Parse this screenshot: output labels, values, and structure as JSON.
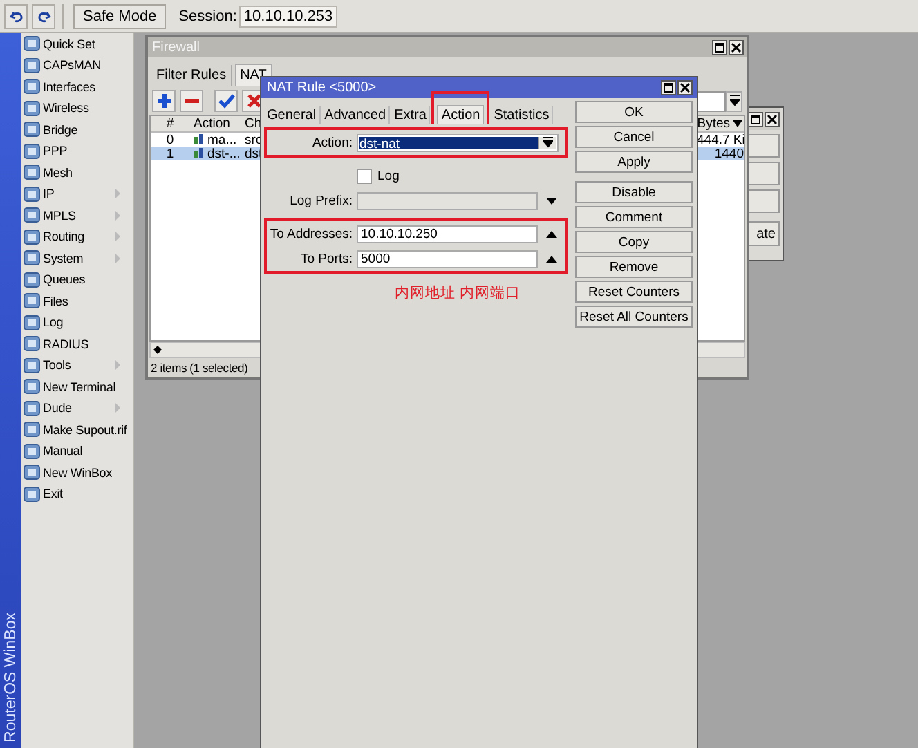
{
  "toolbar": {
    "safe_mode": "Safe Mode",
    "session_label": "Session:",
    "session": "10.10.10.253"
  },
  "sidebar": {
    "brand": "RouterOS WinBox",
    "items": [
      {
        "label": "Quick Set",
        "submenu": false
      },
      {
        "label": "CAPsMAN",
        "submenu": false
      },
      {
        "label": "Interfaces",
        "submenu": false
      },
      {
        "label": "Wireless",
        "submenu": false
      },
      {
        "label": "Bridge",
        "submenu": false
      },
      {
        "label": "PPP",
        "submenu": false
      },
      {
        "label": "Mesh",
        "submenu": false
      },
      {
        "label": "IP",
        "submenu": true
      },
      {
        "label": "MPLS",
        "submenu": true
      },
      {
        "label": "Routing",
        "submenu": true
      },
      {
        "label": "System",
        "submenu": true
      },
      {
        "label": "Queues",
        "submenu": false
      },
      {
        "label": "Files",
        "submenu": false
      },
      {
        "label": "Log",
        "submenu": false
      },
      {
        "label": "RADIUS",
        "submenu": false
      },
      {
        "label": "Tools",
        "submenu": true
      },
      {
        "label": "New Terminal",
        "submenu": false
      },
      {
        "label": "Dude",
        "submenu": true
      },
      {
        "label": "Make Supout.rif",
        "submenu": false
      },
      {
        "label": "Manual",
        "submenu": false
      },
      {
        "label": "New WinBox",
        "submenu": false
      },
      {
        "label": "Exit",
        "submenu": false
      }
    ]
  },
  "firewall": {
    "title": "Firewall",
    "tabs": [
      {
        "label": "Filter Rules",
        "selected": false
      },
      {
        "label": "NAT",
        "selected": true
      }
    ],
    "columns": [
      "#",
      "Action",
      "Ch"
    ],
    "bytes_column": "Bytes",
    "rows": [
      {
        "number": "0",
        "action": "ma...",
        "chain": "src",
        "bytes": "444.7 Ki",
        "selected": false
      },
      {
        "number": "1",
        "action": "dst-...",
        "chain": "dst",
        "bytes": "1440",
        "selected": true
      }
    ],
    "status": "2 items (1 selected)"
  },
  "back_window": {
    "button": "ate"
  },
  "nat_rule": {
    "title": "NAT Rule <5000>",
    "tabs": [
      {
        "label": "General",
        "selected": false,
        "marked": false
      },
      {
        "label": "Advanced",
        "selected": false,
        "marked": false
      },
      {
        "label": "Extra",
        "selected": false,
        "marked": false
      },
      {
        "label": "Action",
        "selected": true,
        "marked": true
      },
      {
        "label": "Statistics",
        "selected": false,
        "marked": false
      }
    ],
    "sections": [
      {
        "marked": true,
        "fields": [
          {
            "kind": "select",
            "label": "Action:",
            "value": "dst-nat",
            "highlighted": true
          }
        ]
      },
      {
        "marked": false,
        "fields": [
          {
            "kind": "checkbox",
            "label": "Log",
            "checked": false
          },
          {
            "kind": "combo",
            "label": "Log Prefix:",
            "disabled": true
          }
        ]
      },
      {
        "marked": true,
        "fields": [
          {
            "kind": "text",
            "label": "To Addresses:",
            "value": "10.10.10.250"
          },
          {
            "kind": "text",
            "label": "To Ports:",
            "value": "5000"
          }
        ]
      }
    ],
    "buttons": [
      [
        "OK",
        "Cancel",
        "Apply"
      ],
      [
        "Disable",
        "Comment",
        "Copy",
        "Remove",
        "Reset Counters",
        "Reset All Counters"
      ]
    ],
    "annotation": "内网地址 内网端口"
  }
}
